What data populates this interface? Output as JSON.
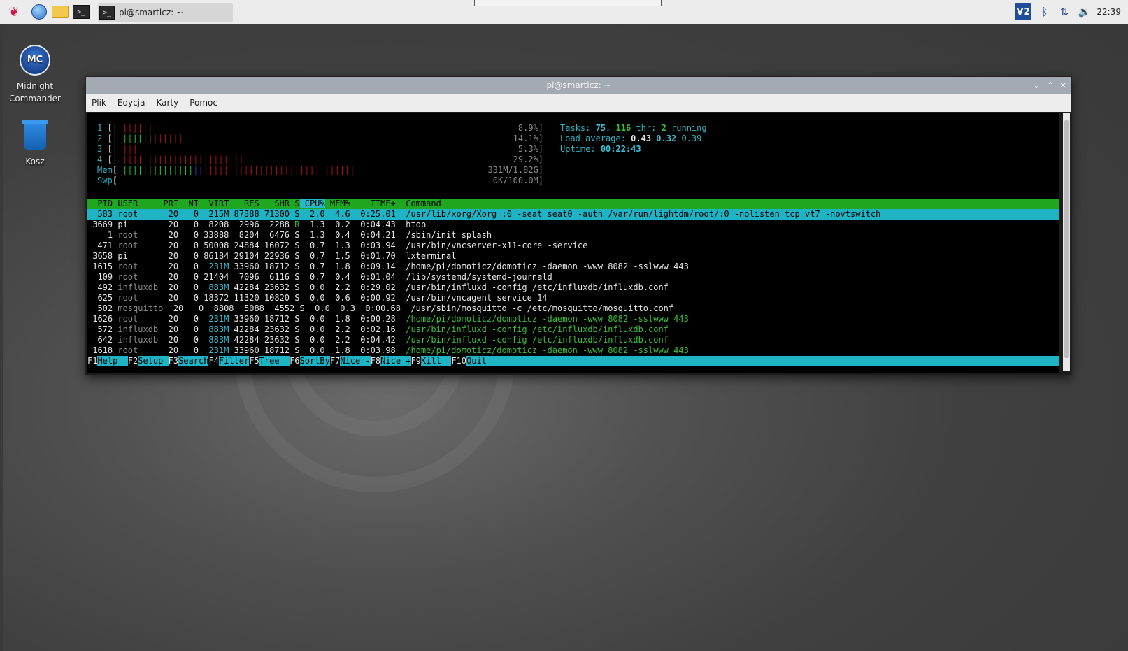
{
  "taskbar": {
    "task_label": "pi@smarticz: ~",
    "clock": "22:39",
    "icons": [
      "raspberry-menu-icon",
      "browser-icon",
      "file-manager-icon",
      "terminal-icon"
    ],
    "tray": [
      "vnc-icon",
      "bluetooth-icon",
      "network-icon",
      "volume-icon"
    ],
    "vnc_label": "V2"
  },
  "desktop": {
    "icons": [
      {
        "label_line1": "Midnight",
        "label_line2": "Commander",
        "logo": "MC"
      },
      {
        "label": "Kosz"
      }
    ]
  },
  "window": {
    "title": "pi@smarticz: ~",
    "menu": [
      "Plik",
      "Edycja",
      "Karty",
      "Pomoc"
    ]
  },
  "htop": {
    "cpus": [
      {
        "id": "1",
        "percent": "8.9%",
        "green_bars": "|",
        "red_bars": "|||||||"
      },
      {
        "id": "2",
        "percent": "14.1%",
        "green_bars": "||||||||",
        "red_bars": "||||||"
      },
      {
        "id": "3",
        "percent": "5.3%",
        "green_bars": "||",
        "red_bars": "|||"
      },
      {
        "id": "4",
        "percent": "29.2%",
        "green_bars": "|",
        "red_bars": "|||||||||||||||||||||||||"
      }
    ],
    "mem": {
      "label": "Mem",
      "value": "331M/1.82G",
      "green_bars": "|||||||||||||||",
      "blue_bars": "||",
      "red_bars": "||||||||||||||||||||||||||||||"
    },
    "swp": {
      "label": "Swp",
      "value": "0K/100.0M"
    },
    "tasks": {
      "label": "Tasks:",
      "count": "75",
      "thr": "116",
      "thr_label": "thr;",
      "running": "2",
      "running_label": "running"
    },
    "load": {
      "label": "Load average:",
      "l1": "0.43",
      "l5": "0.32",
      "l15": "0.39"
    },
    "uptime": {
      "label": "Uptime:",
      "value": "00:22:43"
    },
    "columns": [
      "PID",
      "USER",
      "PRI",
      "NI",
      "VIRT",
      "RES",
      "SHR",
      "S",
      "CPU%",
      "MEM%",
      "TIME+",
      "Command"
    ],
    "processes": [
      {
        "pid": "583",
        "user": "root",
        "pri": "20",
        "ni": "0",
        "virt": "215M",
        "res": "87388",
        "shr": "71300",
        "s": "S",
        "cpu": "2.0",
        "mem": "4.6",
        "time": "0:25.01",
        "cmd": "/usr/lib/xorg/Xorg :0 -seat seat0 -auth /var/run/lightdm/root/:0 -nolisten tcp vt7 -novtswitch",
        "selected": true
      },
      {
        "pid": "3669",
        "user": "pi",
        "pri": "20",
        "ni": "0",
        "virt": "8208",
        "res": "2996",
        "shr": "2288",
        "s": "R",
        "cpu": "1.3",
        "mem": "0.2",
        "time": "0:04.43",
        "cmd": "htop"
      },
      {
        "pid": "1",
        "user": "root",
        "pri": "20",
        "ni": "0",
        "virt": "33888",
        "res": "8204",
        "shr": "6476",
        "s": "S",
        "cpu": "1.3",
        "mem": "0.4",
        "time": "0:04.21",
        "cmd": "/sbin/init splash"
      },
      {
        "pid": "471",
        "user": "root",
        "pri": "20",
        "ni": "0",
        "virt": "50008",
        "res": "24884",
        "shr": "16072",
        "s": "S",
        "cpu": "0.7",
        "mem": "1.3",
        "time": "0:03.94",
        "cmd": "/usr/bin/vncserver-x11-core -service"
      },
      {
        "pid": "3658",
        "user": "pi",
        "pri": "20",
        "ni": "0",
        "virt": "86184",
        "res": "29104",
        "shr": "22936",
        "s": "S",
        "cpu": "0.7",
        "mem": "1.5",
        "time": "0:01.70",
        "cmd": "lxterminal"
      },
      {
        "pid": "1615",
        "user": "root",
        "pri": "20",
        "ni": "0",
        "virt": "231M",
        "res": "33960",
        "shr": "18712",
        "s": "S",
        "cpu": "0.7",
        "mem": "1.8",
        "time": "0:09.14",
        "cmd": "/home/pi/domoticz/domoticz -daemon -www 8082 -sslwww 443"
      },
      {
        "pid": "109",
        "user": "root",
        "pri": "20",
        "ni": "0",
        "virt": "21404",
        "res": "7096",
        "shr": "6116",
        "s": "S",
        "cpu": "0.7",
        "mem": "0.4",
        "time": "0:01.04",
        "cmd": "/lib/systemd/systemd-journald"
      },
      {
        "pid": "492",
        "user": "influxdb",
        "pri": "20",
        "ni": "0",
        "virt": "883M",
        "res": "42284",
        "shr": "23632",
        "s": "S",
        "cpu": "0.0",
        "mem": "2.2",
        "time": "0:29.02",
        "cmd": "/usr/bin/influxd -config /etc/influxdb/influxdb.conf"
      },
      {
        "pid": "625",
        "user": "root",
        "pri": "20",
        "ni": "0",
        "virt": "18372",
        "res": "11320",
        "shr": "10820",
        "s": "S",
        "cpu": "0.0",
        "mem": "0.6",
        "time": "0:00.92",
        "cmd": "/usr/bin/vncagent service 14"
      },
      {
        "pid": "502",
        "user": "mosquitto",
        "pri": "20",
        "ni": "0",
        "virt": "8808",
        "res": "5088",
        "shr": "4552",
        "s": "S",
        "cpu": "0.0",
        "mem": "0.3",
        "time": "0:00.68",
        "cmd": "/usr/sbin/mosquitto -c /etc/mosquitto/mosquitto.conf"
      },
      {
        "pid": "1626",
        "user": "root",
        "pri": "20",
        "ni": "0",
        "virt": "231M",
        "res": "33960",
        "shr": "18712",
        "s": "S",
        "cpu": "0.0",
        "mem": "1.8",
        "time": "0:00.28",
        "cmd": "/home/pi/domoticz/domoticz -daemon -www 8082 -sslwww 443",
        "thread": true
      },
      {
        "pid": "572",
        "user": "influxdb",
        "pri": "20",
        "ni": "0",
        "virt": "883M",
        "res": "42284",
        "shr": "23632",
        "s": "S",
        "cpu": "0.0",
        "mem": "2.2",
        "time": "0:02.16",
        "cmd": "/usr/bin/influxd -config /etc/influxdb/influxdb.conf",
        "thread": true
      },
      {
        "pid": "642",
        "user": "influxdb",
        "pri": "20",
        "ni": "0",
        "virt": "883M",
        "res": "42284",
        "shr": "23632",
        "s": "S",
        "cpu": "0.0",
        "mem": "2.2",
        "time": "0:04.42",
        "cmd": "/usr/bin/influxd -config /etc/influxdb/influxdb.conf",
        "thread": true
      },
      {
        "pid": "1618",
        "user": "root",
        "pri": "20",
        "ni": "0",
        "virt": "231M",
        "res": "33960",
        "shr": "18712",
        "s": "S",
        "cpu": "0.0",
        "mem": "1.8",
        "time": "0:03.98",
        "cmd": "/home/pi/domoticz/domoticz -daemon -www 8082 -sslwww 443",
        "thread": true
      }
    ],
    "fkeys": [
      {
        "key": "F1",
        "label": "Help  "
      },
      {
        "key": "F2",
        "label": "Setup "
      },
      {
        "key": "F3",
        "label": "Search"
      },
      {
        "key": "F4",
        "label": "Filter"
      },
      {
        "key": "F5",
        "label": "Tree  "
      },
      {
        "key": "F6",
        "label": "SortBy"
      },
      {
        "key": "F7",
        "label": "Nice -"
      },
      {
        "key": "F8",
        "label": "Nice +"
      },
      {
        "key": "F9",
        "label": "Kill  "
      },
      {
        "key": "F10",
        "label": "Quit"
      }
    ]
  },
  "colors": {
    "header_green": "#1fa81f",
    "select_cyan": "#1fb4c4",
    "bar_green": "#2bbd2b",
    "bar_red": "#a81212",
    "bar_blue": "#2a3fb0"
  }
}
